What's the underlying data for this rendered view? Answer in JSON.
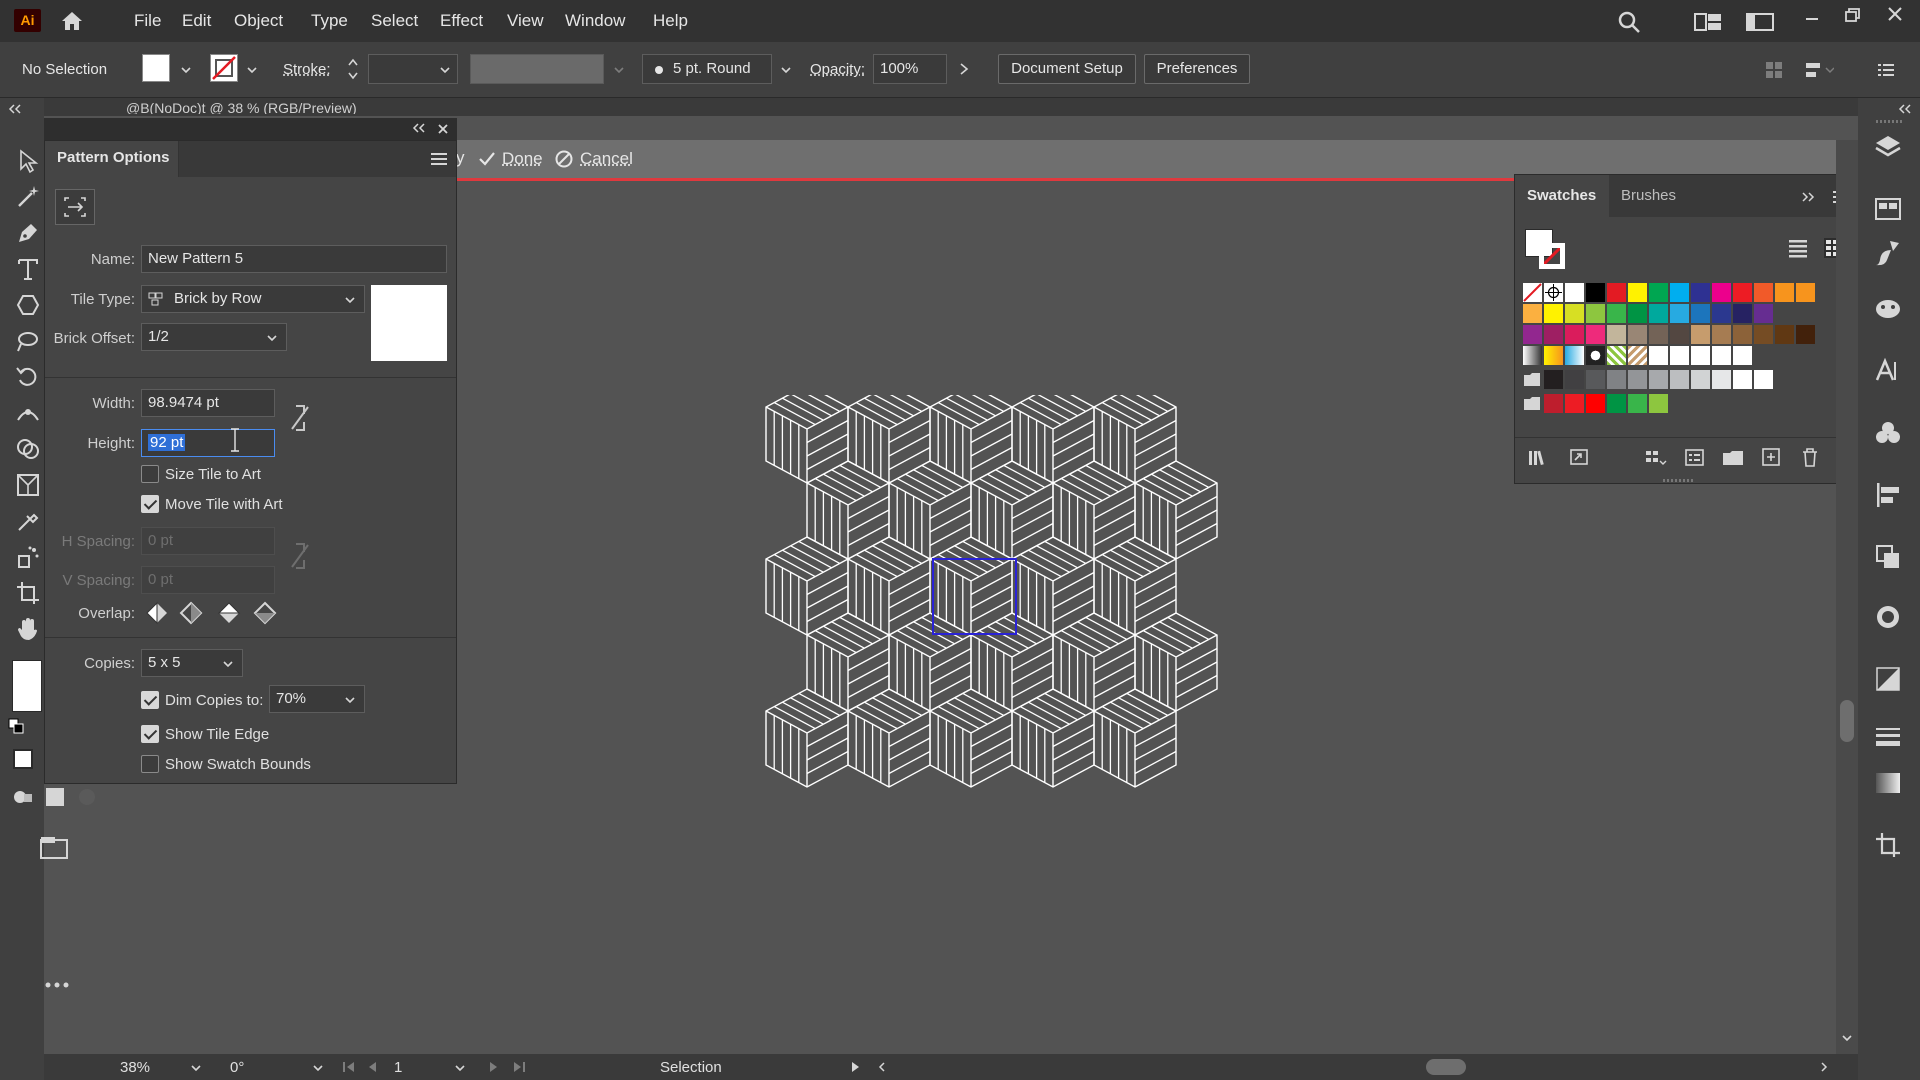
{
  "app": {
    "logo": "Ai",
    "home_icon": "home-icon"
  },
  "menu": [
    "File",
    "Edit",
    "Object",
    "Type",
    "Select",
    "Effect",
    "View",
    "Window",
    "Help"
  ],
  "control_bar": {
    "selection_label": "No Selection",
    "stroke_label": "Stroke:",
    "brush_label": "5 pt. Round",
    "opacity_label": "Opacity:",
    "opacity_value": "100%",
    "document_setup": "Document Setup",
    "preferences": "Preferences"
  },
  "doc_tab": {
    "title": "@B(NoDoc)t @ 38 % (RGB/Preview)"
  },
  "pattern_bar": {
    "done": "Done",
    "cancel": "Cancel"
  },
  "pattern_options": {
    "title": "Pattern Options",
    "name_label": "Name:",
    "name_value": "New Pattern 5",
    "tile_type_label": "Tile Type:",
    "tile_type_value": "Brick by Row",
    "brick_offset_label": "Brick Offset:",
    "brick_offset_value": "1/2",
    "width_label": "Width:",
    "width_value": "98.9474 pt",
    "height_label": "Height:",
    "height_value": "92 pt",
    "size_tile_label": "Size Tile to Art",
    "size_tile_checked": false,
    "move_tile_label": "Move Tile with Art",
    "move_tile_checked": true,
    "h_spacing_label": "H Spacing:",
    "h_spacing_value": "0 pt",
    "v_spacing_label": "V Spacing:",
    "v_spacing_value": "0 pt",
    "overlap_label": "Overlap:",
    "copies_label": "Copies:",
    "copies_value": "5 x 5",
    "dim_copies_label": "Dim Copies to:",
    "dim_copies_checked": true,
    "dim_copies_value": "70%",
    "show_tile_edge_label": "Show Tile Edge",
    "show_tile_edge_checked": true,
    "show_swatch_bounds_label": "Show Swatch Bounds",
    "show_swatch_bounds_checked": false
  },
  "swatches_panel": {
    "tab_swatches": "Swatches",
    "tab_brushes": "Brushes",
    "rows": [
      [
        "none",
        "reg",
        "#ffffff",
        "#000000",
        "#e31b23",
        "#fff200",
        "#00a651",
        "#00aeef",
        "#2e3192",
        "#ec008c",
        "#ed1c24",
        "#f15a29",
        "#f7941d",
        "#f7941d"
      ],
      [
        "#fbb040",
        "#fff200",
        "#d7df23",
        "#8dc63f",
        "#39b54a",
        "#009444",
        "#00a99d",
        "#27aae1",
        "#1c75bc",
        "#2b388f",
        "#262262",
        "#662d91"
      ],
      [
        "#92278f",
        "#9e1f63",
        "#da1c5c",
        "#ee2a7b",
        "#c2b59b",
        "#998675",
        "#736357",
        "#534741",
        "#c69c6d",
        "#a67c52",
        "#8c6239",
        "#754c24",
        "#603813",
        "#42210b"
      ],
      [
        "grad1",
        "grad2",
        "grad3",
        "grad4",
        "pat1",
        "pat2",
        "#ffffff",
        "#ffffff",
        "#ffffff",
        "#ffffff",
        "#ffffff"
      ],
      [
        "folder",
        "#231f20",
        "#414042",
        "#58595b",
        "#808285",
        "#939598",
        "#a7a9ac",
        "#bcbec0",
        "#d1d3d4",
        "#e6e7e8",
        "#ffffff",
        "#ffffff"
      ],
      [
        "folder",
        "#be1e2d",
        "#ed1c24",
        "#ff0000",
        "#009444",
        "#39b54a",
        "#8dc63f"
      ]
    ]
  },
  "status_bar": {
    "zoom": "38%",
    "rotation": "0°",
    "artboard": "1",
    "tool": "Selection"
  },
  "colors": {
    "accent_red": "#e0393e",
    "tile_edge": "#2a22d6",
    "pattern_stroke": "#ffffff"
  }
}
